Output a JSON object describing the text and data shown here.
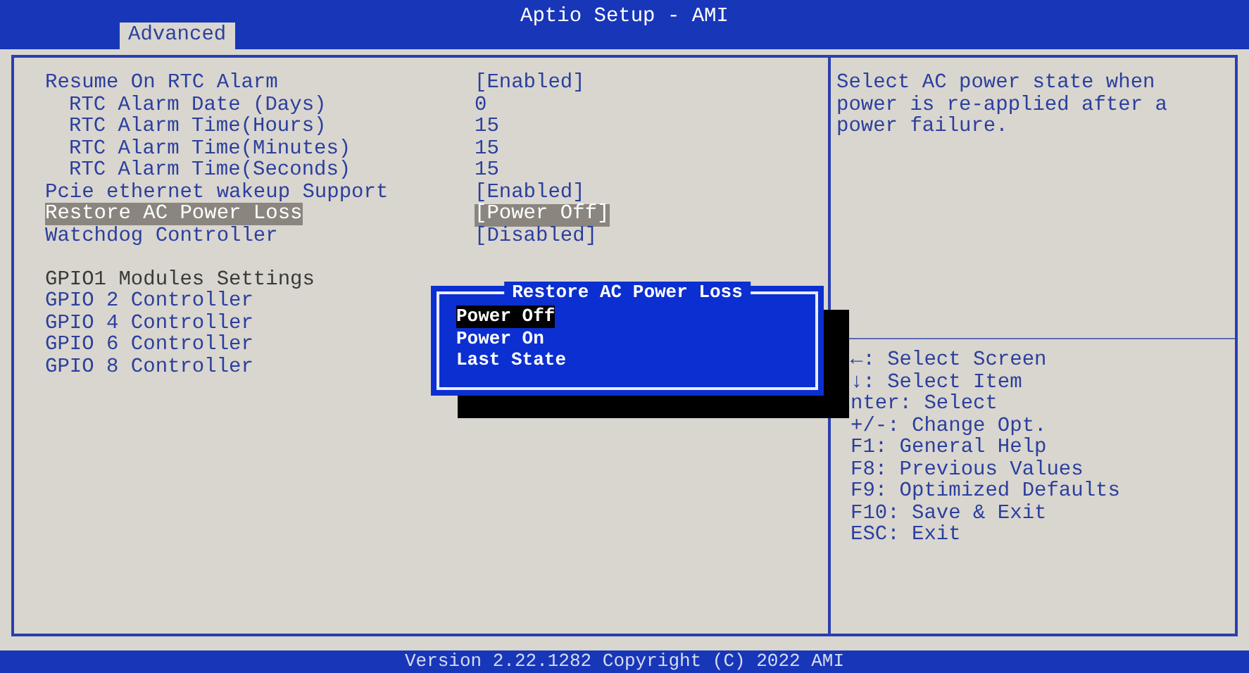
{
  "header": {
    "title": "Aptio Setup - AMI",
    "tabs": [
      {
        "label": "Advanced",
        "selected": true
      }
    ]
  },
  "settings": [
    {
      "kind": "setting",
      "label": "Resume On RTC Alarm",
      "value": "[Enabled]",
      "selected": false,
      "children": [
        {
          "kind": "setting",
          "label": "RTC Alarm Date (Days)",
          "value": "0",
          "selected": false
        },
        {
          "kind": "setting",
          "label": "RTC Alarm Time(Hours)",
          "value": "15",
          "selected": false
        },
        {
          "kind": "setting",
          "label": "RTC Alarm Time(Minutes)",
          "value": "15",
          "selected": false
        },
        {
          "kind": "setting",
          "label": "RTC Alarm Time(Seconds)",
          "value": "15",
          "selected": false
        }
      ]
    },
    {
      "kind": "setting",
      "label": "Pcie ethernet wakeup Support",
      "value": "[Enabled]",
      "selected": false
    },
    {
      "kind": "setting",
      "label": "Restore AC Power Loss",
      "value": "[Power Off]",
      "selected": true
    },
    {
      "kind": "setting",
      "label": "Watchdog Controller",
      "value": "[Disabled]",
      "selected": false
    },
    {
      "kind": "subtitle",
      "label": "GPIO1 Modules Settings"
    },
    {
      "kind": "setting",
      "label": "GPIO 2 Controller",
      "selected": false
    },
    {
      "kind": "setting",
      "label": "GPIO 4 Controller",
      "selected": false
    },
    {
      "kind": "setting",
      "label": "GPIO 6 Controller",
      "selected": false
    },
    {
      "kind": "setting",
      "label": "GPIO 8 Controller",
      "selected": false
    }
  ],
  "help": {
    "description": "Select AC power state when power is re-applied after a power failure.",
    "keys": [
      "←: Select Screen",
      "↓: Select Item",
      "nter: Select",
      "+/-: Change Opt.",
      "F1: General Help",
      "F8: Previous Values",
      "F9: Optimized Defaults",
      "F10: Save & Exit",
      "ESC: Exit"
    ]
  },
  "popup": {
    "title": "Restore AC Power Loss",
    "options": [
      {
        "label": "Power Off",
        "selected": true
      },
      {
        "label": "Power On",
        "selected": false
      },
      {
        "label": "Last State",
        "selected": false
      }
    ]
  },
  "footer": "Version 2.22.1282 Copyright (C) 2022 AMI"
}
